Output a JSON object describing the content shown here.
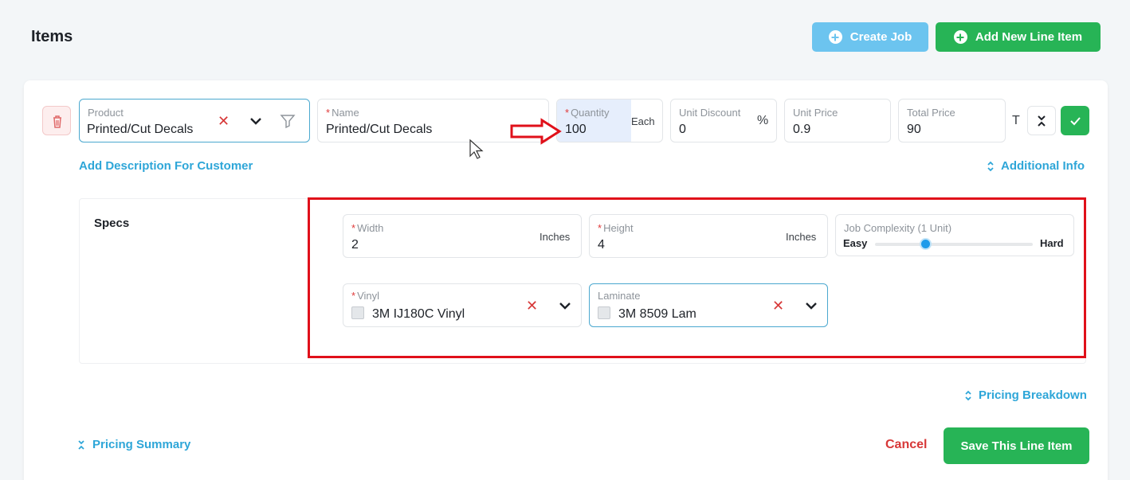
{
  "header": {
    "title": "Items",
    "create_job_label": "Create Job",
    "add_line_item_label": "Add New Line Item"
  },
  "line_item": {
    "product": {
      "label": "Product",
      "value": "Printed/Cut Decals"
    },
    "name": {
      "label": "Name",
      "value": "Printed/Cut Decals"
    },
    "quantity": {
      "label": "Quantity",
      "value": "100",
      "unit": "Each"
    },
    "unit_discount": {
      "label": "Unit Discount",
      "value": "0",
      "unit": "%"
    },
    "unit_price": {
      "label": "Unit Price",
      "value": "0.9"
    },
    "total_price": {
      "label": "Total Price",
      "value": "90"
    },
    "t_label": "T",
    "add_description_link": "Add Description For Customer",
    "additional_info_link": "Additional Info"
  },
  "specs": {
    "title": "Specs",
    "width": {
      "label": "Width",
      "value": "2",
      "unit": "Inches"
    },
    "height": {
      "label": "Height",
      "value": "4",
      "unit": "Inches"
    },
    "job_complexity": {
      "label": "Job Complexity (1 Unit)",
      "min_label": "Easy",
      "max_label": "Hard",
      "level": 0.32
    },
    "vinyl": {
      "label": "Vinyl",
      "value": "3M IJ180C Vinyl"
    },
    "laminate": {
      "label": "Laminate",
      "value": "3M 8509 Lam"
    }
  },
  "footer": {
    "pricing_breakdown_link": "Pricing Breakdown",
    "pricing_summary_link": "Pricing Summary",
    "cancel_label": "Cancel",
    "save_label": "Save This Line Item"
  },
  "colors": {
    "accent_blue": "#2ea6d8",
    "create_job_bg": "#6cc4ef",
    "green": "#27b456",
    "danger": "#d73838",
    "highlight_frame": "#e0101a"
  }
}
